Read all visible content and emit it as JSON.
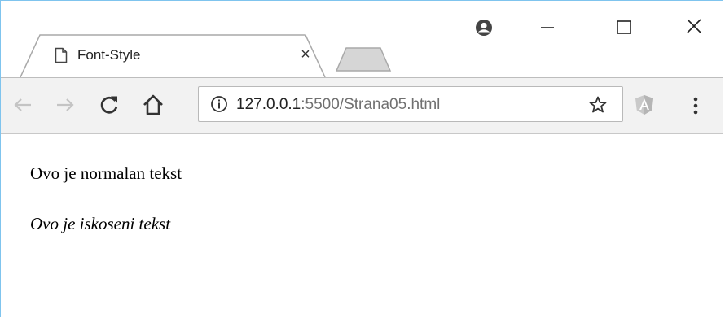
{
  "tab": {
    "title": "Font-Style",
    "close_glyph": "×"
  },
  "window_controls": {
    "minimize": "—",
    "maximize": "☐",
    "close": "✕"
  },
  "address": {
    "host": "127.0.0.1",
    "path": ":5500/Strana05.html"
  },
  "icons": {
    "page": "page-icon",
    "profile": "profile-icon",
    "back": "back-arrow-icon",
    "forward": "forward-arrow-icon",
    "reload": "reload-icon",
    "home": "home-icon",
    "info": "info-icon",
    "star": "star-icon",
    "extension": "angular-extension-icon",
    "menu": "kebab-menu-icon"
  },
  "content": {
    "normal_text": "Ovo je normalan tekst",
    "italic_text": "Ovo je iskoseni tekst"
  },
  "colors": {
    "window_border": "#7fc4ee",
    "toolbar_bg": "#f2f2f2",
    "url_path": "#707070"
  }
}
